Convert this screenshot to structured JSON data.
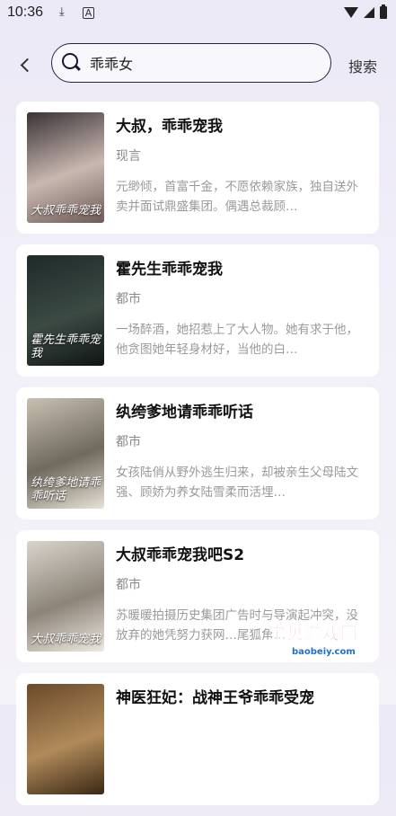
{
  "status_bar": {
    "time": "10:36",
    "icons": [
      "download-icon",
      "a-icon",
      "wifi-icon",
      "signal-icon",
      "battery-icon"
    ]
  },
  "search": {
    "value": "乖乖女",
    "button_label": "搜索"
  },
  "results": [
    {
      "title": "大叔，乖乖宠我",
      "genre": "现言",
      "description": "元缈倾，首富千金，不愿依赖家族，独自送外卖并面试鼎盛集团。偶遇总裁顾…",
      "cover_text": "大叔乖乖宠我",
      "cover_colors": [
        "#3a3236",
        "#c9b8b0",
        "#6d5a56"
      ]
    },
    {
      "title": "霍先生乖乖宠我",
      "genre": "都市",
      "description": "一场醉酒，她招惹上了大人物。她有求于他，他贪图她年轻身材好，当他的白…",
      "cover_text": "霍先生乖乖宠我",
      "cover_colors": [
        "#1d2a2a",
        "#3c4a44",
        "#0f1514"
      ]
    },
    {
      "title": "纨绔爹地请乖乖听话",
      "genre": "都市",
      "description": "女孩陆俏从野外逃生归来，却被亲生父母陆文强、顾娇为养女陆雪柔而活埋…",
      "cover_text": "纨绔爹地请乖乖听话",
      "cover_colors": [
        "#c9c0b2",
        "#6f6a5c",
        "#e8e2d8"
      ]
    },
    {
      "title": "大叔乖乖宠我吧S2",
      "genre": "都市",
      "description": "苏暖暖拍摄历史集团广告时与导演起冲突，没放弃的她凭努力获网…尾狐角…",
      "cover_text": "大叔乖乖宠我",
      "cover_colors": [
        "#d9d4cc",
        "#8c8478",
        "#efe9e1"
      ]
    },
    {
      "title": "神医狂妃：战神王爷乖乖受宠",
      "genre": "",
      "description": "",
      "cover_text": "",
      "cover_colors": [
        "#6b4a2a",
        "#b08a5a",
        "#3a2814"
      ]
    }
  ],
  "watermark": {
    "main": "宝贝游戏网",
    "url": "baobeiy.com"
  }
}
